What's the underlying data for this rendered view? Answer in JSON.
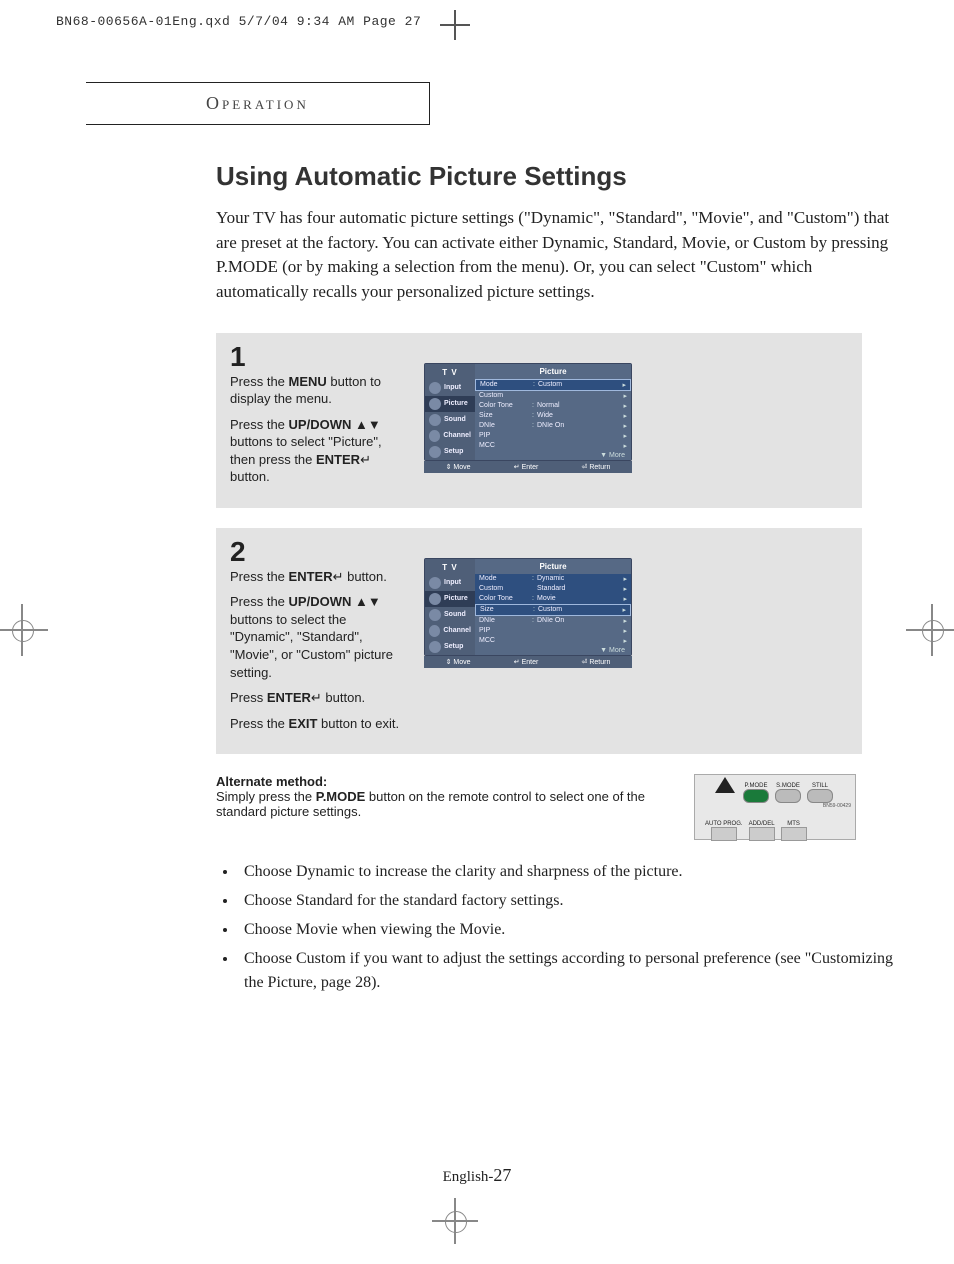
{
  "print_header": "BN68-00656A-01Eng.qxd  5/7/04 9:34 AM  Page 27",
  "section_label": "Operation",
  "title": "Using Automatic Picture Settings",
  "intro": "Your TV has four automatic picture settings (\"Dynamic\", \"Standard\", \"Movie\", and \"Custom\") that are preset at the factory. You can activate either Dynamic, Standard, Movie, or Custom by pressing P.MODE (or by making a selection from the menu). Or, you can select \"Custom\" which automatically recalls your personalized picture settings.",
  "steps": [
    {
      "num": "1",
      "para1_a": "Press the ",
      "para1_b": "MENU",
      "para1_c": " button to display the menu.",
      "para2_a": "Press the ",
      "para2_b": "UP/DOWN",
      "para2_c": " ▲▼ buttons to select \"Picture\", then press the ",
      "para2_d": "ENTER",
      "para2_e": "↵ button.",
      "osd": {
        "tv": "T V",
        "title": "Picture",
        "nav": [
          "Input",
          "Picture",
          "Sound",
          "Channel",
          "Setup"
        ],
        "nav_sel": 1,
        "rows": [
          {
            "k": "Mode",
            "c": ":",
            "v": "Custom",
            "hl": true
          },
          {
            "k": "Custom",
            "c": "",
            "v": ""
          },
          {
            "k": "Color Tone",
            "c": ":",
            "v": "Normal"
          },
          {
            "k": "Size",
            "c": ":",
            "v": "Wide"
          },
          {
            "k": "DNIe",
            "c": ":",
            "v": "DNIe On"
          },
          {
            "k": "PIP",
            "c": "",
            "v": ""
          },
          {
            "k": "MCC",
            "c": "",
            "v": ""
          }
        ],
        "more": "▼  More",
        "foot": [
          "⇕ Move",
          "↵ Enter",
          "⏎ Return"
        ]
      }
    },
    {
      "num": "2",
      "para1_a": "Press the ",
      "para1_b": "ENTER",
      "para1_c": "↵ button.",
      "para2_a": "Press the ",
      "para2_b": "UP/DOWN",
      "para2_c": " ▲▼ buttons to select the \"Dynamic\", \"Standard\", \"Movie\", or \"Custom\" picture setting.",
      "para3_a": "Press ",
      "para3_b": "ENTER",
      "para3_c": "↵ button.",
      "para4_a": "Press the ",
      "para4_b": "EXIT",
      "para4_c": " button to exit.",
      "osd": {
        "tv": "T V",
        "title": "Picture",
        "nav": [
          "Input",
          "Picture",
          "Sound",
          "Channel",
          "Setup"
        ],
        "nav_sel": 1,
        "rows": [
          {
            "k": "Mode",
            "c": ":",
            "v": "Dynamic",
            "subhl": true
          },
          {
            "k": "Custom",
            "c": "",
            "v": "Standard",
            "subhl": true
          },
          {
            "k": "Color Tone",
            "c": ":",
            "v": "Movie",
            "subhl": true
          },
          {
            "k": "Size",
            "c": ":",
            "v": "Custom",
            "hl": true
          },
          {
            "k": "DNIe",
            "c": ":",
            "v": "DNIe On"
          },
          {
            "k": "PIP",
            "c": "",
            "v": ""
          },
          {
            "k": "MCC",
            "c": "",
            "v": ""
          }
        ],
        "more": "▼  More",
        "foot": [
          "⇕ Move",
          "↵ Enter",
          "⏎ Return"
        ]
      }
    }
  ],
  "alt": {
    "heading": "Alternate method:",
    "body_a": "Simply press the ",
    "body_b": "P.MODE",
    "body_c": " button on the remote control to select one of the standard picture settings."
  },
  "remote": {
    "row1": [
      "P.MODE",
      "S.MODE",
      "STILL"
    ],
    "row2": [
      "AUTO PROG.",
      "ADD/DEL",
      "MTS"
    ],
    "serial": "BN59-00429"
  },
  "bullets": [
    "Choose Dynamic to increase the clarity and sharpness of the picture.",
    "Choose Standard for the standard factory settings.",
    "Choose Movie when viewing the Movie.",
    "Choose Custom if you want to adjust the settings according to personal preference (see \"Customizing the Picture, page 28)."
  ],
  "pagenum_prefix": "English-",
  "pagenum": "27"
}
